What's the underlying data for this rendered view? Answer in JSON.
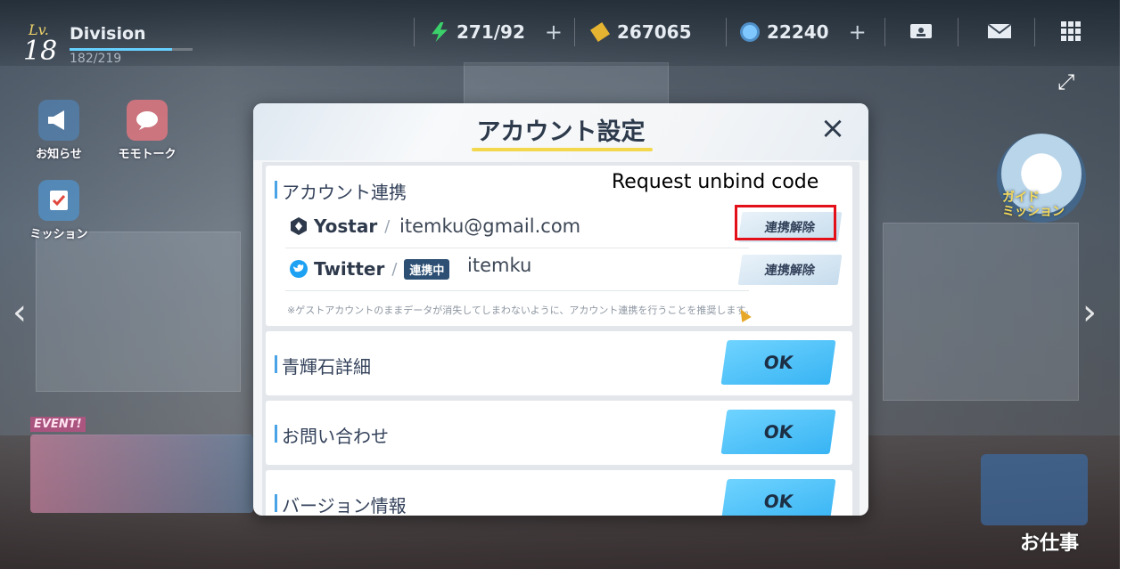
{
  "player": {
    "level_label": "Lv.",
    "level": "18",
    "name": "Division",
    "exp": "182/219",
    "exp_fraction": 0.83
  },
  "resources": [
    {
      "name": "AP",
      "icon": "lightning-icon",
      "value": "271/92",
      "plus": "+"
    },
    {
      "name": "Credits",
      "icon": "credit-icon",
      "value": "267065"
    },
    {
      "name": "Pyroxene",
      "icon": "gem-icon",
      "value": "22240",
      "plus": "+"
    }
  ],
  "hud_buttons": [
    "id-card-icon",
    "mail-icon",
    "grid-menu-icon"
  ],
  "side_menu": [
    {
      "label": "お知らせ",
      "icon": "megaphone-icon"
    },
    {
      "label": "モモトーク",
      "icon": "momotalk-icon"
    },
    {
      "label": "ミッション",
      "icon": "mission-icon"
    }
  ],
  "event_tag": "EVENT!",
  "guide": {
    "label_top": "ガイド",
    "label_bottom": "ミッション"
  },
  "work_button": "お仕事",
  "modal": {
    "title": "アカウント設定",
    "close": "×",
    "link_section": {
      "title": "アカウント連携",
      "rows": [
        {
          "provider": "Yostar",
          "account": "itemku@gmail.com",
          "unlink": "連携解除"
        },
        {
          "provider": "Twitter",
          "status": "連携中",
          "account": "itemku",
          "unlink": "連携解除"
        }
      ],
      "note": "※ゲストアカウントのままデータが消失してしまわないように、アカウント連携を行うことを推奨します。"
    },
    "sections": [
      {
        "title": "青輝石詳細",
        "button": "OK"
      },
      {
        "title": "お問い合わせ",
        "button": "OK"
      },
      {
        "title": "バージョン情報",
        "button": "OK"
      }
    ]
  },
  "annotation": {
    "text": "Request unbind code",
    "color": "#e3101a"
  },
  "colors": {
    "accent": "#38b4f3",
    "title_underline": "#f3d84e",
    "link_tag": "#2c4f73"
  }
}
